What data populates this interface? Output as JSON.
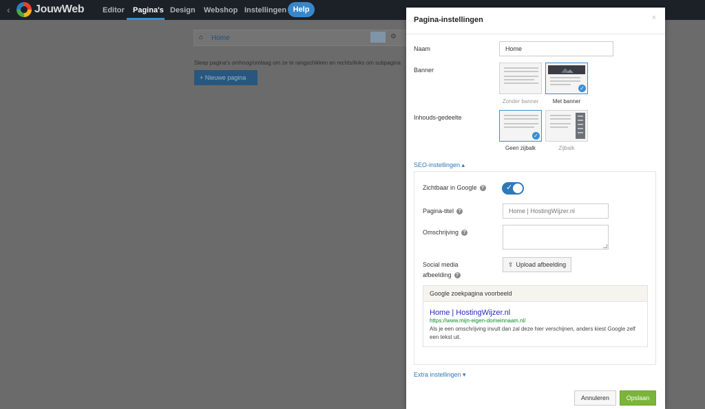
{
  "topbar": {
    "logo_text": "JouwWeb",
    "nav": [
      {
        "label": "Editor"
      },
      {
        "label": "Pagina's"
      },
      {
        "label": "Design"
      },
      {
        "label": "Webshop"
      },
      {
        "label": "Instellingen"
      }
    ],
    "active_nav": "Pagina's",
    "help_label": "Help"
  },
  "background": {
    "home_label": "Home",
    "hint_text": "Sleep pagina's omhoog/omlaag om ze te rangschikken en rechts/links om subpagina",
    "new_page_label": "+  Nieuwe pagina"
  },
  "modal": {
    "title": "Pagina-instellingen",
    "close_symbol": "×",
    "naam_label": "Naam",
    "naam_value": "Home",
    "banner_label": "Banner",
    "banner_options": [
      {
        "caption": "Zonder banner",
        "selected": false
      },
      {
        "caption": "Met banner",
        "selected": true
      }
    ],
    "content_label": "Inhouds-gedeelte",
    "content_options": [
      {
        "caption": "Geen zijbalk",
        "selected": true
      },
      {
        "caption": "Zijbalk",
        "selected": false
      }
    ],
    "seo_toggle": "SEO-instellingen ▴",
    "seo": {
      "visible_label": "Zichtbaar in Google",
      "visible_on": true,
      "page_title_label": "Pagina-titel",
      "page_title_placeholder": "Home | HostingWijzer.nl",
      "description_label": "Omschrijving",
      "social_label_1": "Social media",
      "social_label_2": "afbeelding",
      "upload_label": "Upload afbeelding",
      "preview_header": "Google zoekpagina voorbeeld",
      "preview_title": "Home | HostingWijzer.nl",
      "preview_url": "https://www.mijn-eigen-domeinnaam.nl/",
      "preview_description": "Als je een omschrijving invult dan zal deze hier verschijnen, anders kiest Google zelf een tekst uit."
    },
    "extra_toggle": "Extra instellingen ▾",
    "cancel_label": "Annuleren",
    "save_label": "Opslaan"
  },
  "colors": {
    "accent": "#3a8fd0",
    "save_green": "#7ab53a",
    "link_blue": "#2d79b9",
    "preview_title": "#2626c4",
    "preview_url": "#0a8a1f"
  },
  "icons": [
    "back-arrow-icon",
    "logo-icon",
    "home-icon",
    "edit-icon",
    "gear-icon",
    "close-icon",
    "checkmark-icon",
    "help-icon",
    "upload-icon",
    "caret-up-icon",
    "caret-down-icon"
  ]
}
